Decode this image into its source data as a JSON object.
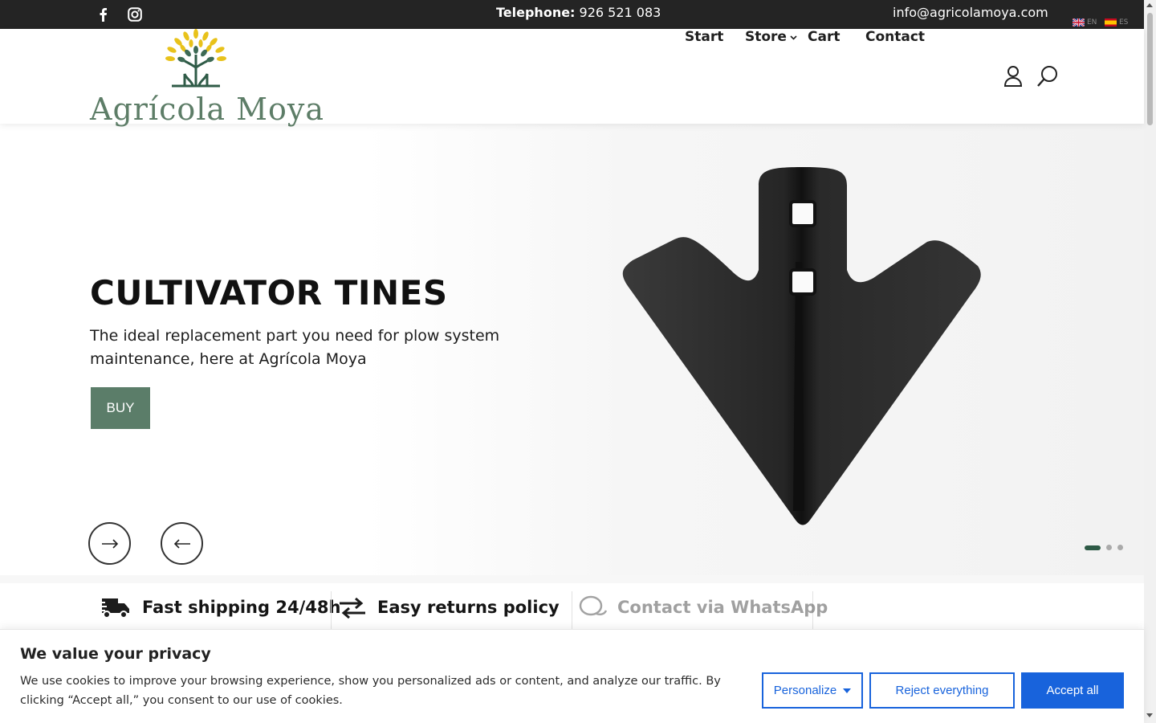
{
  "topbar": {
    "phone_label": "Telephone:",
    "phone_number": "926 521 083",
    "email": "info@agricolamoya.com",
    "languages": [
      {
        "code": "EN",
        "flag": "uk-flag-icon"
      },
      {
        "code": "ES",
        "flag": "spain-flag-icon"
      }
    ],
    "social": [
      "facebook-icon",
      "instagram-icon"
    ]
  },
  "header": {
    "brand": "Agrícola Moya",
    "nav": [
      {
        "label": "Start"
      },
      {
        "label": "Store",
        "has_dropdown": true
      },
      {
        "label": "Cart"
      },
      {
        "label": "Contact"
      }
    ],
    "icons": [
      "user-icon",
      "search-icon"
    ]
  },
  "hero": {
    "title": "CULTIVATOR TINES",
    "subtitle": "The ideal replacement part you need for plow system maintenance, here at Agrícola Moya",
    "cta": "BUY",
    "slides_total": 3,
    "active_slide": 1
  },
  "features": [
    {
      "label": "Fast shipping 24/48h",
      "icon": "delivery-truck-icon"
    },
    {
      "label": "Easy returns policy",
      "icon": "exchange-arrows-icon"
    },
    {
      "label": "Contact via WhatsApp",
      "icon": "chat-bubbles-icon"
    }
  ],
  "cookie": {
    "title": "We value your privacy",
    "text": "We use cookies to improve your browsing experience, show you personalized ads or content, and analyze our traffic. By clicking “Accept all,” you consent to our use of cookies.",
    "personalize": "Personalize",
    "reject": "Reject everything",
    "accept": "Accept all"
  },
  "colors": {
    "brand_green": "#5b7d69",
    "topbar_bg": "#242424",
    "cookie_blue": "#1863dc",
    "logo_yellow": "#e8c21b"
  }
}
